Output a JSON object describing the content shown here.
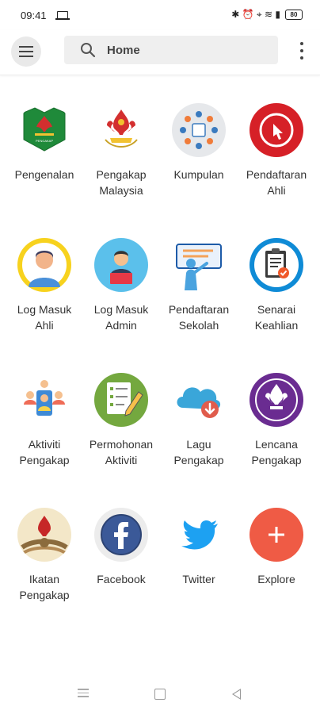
{
  "status_bar": {
    "time": "09:41",
    "right_symbols": "✱ ⏰ ⌖ ≋ ▮",
    "battery": "80"
  },
  "toolbar": {
    "search_text": "Home"
  },
  "tiles": [
    {
      "l1": "Pengenalan",
      "l2": "",
      "icon": "pengakap-emblem-icon"
    },
    {
      "l1": "Pengakap",
      "l2": "Malaysia",
      "icon": "fleur-de-lis-emblem-icon"
    },
    {
      "l1": "Kumpulan",
      "l2": "",
      "icon": "group-meeting-icon"
    },
    {
      "l1": "Pendaftaran",
      "l2": "Ahli",
      "icon": "apply-online-icon"
    },
    {
      "l1": "Log Masuk",
      "l2": "Ahli",
      "icon": "member-avatar-icon"
    },
    {
      "l1": "Log Masuk",
      "l2": "Admin",
      "icon": "admin-laptop-icon"
    },
    {
      "l1": "Pendaftaran",
      "l2": "Sekolah",
      "icon": "school-presentation-icon"
    },
    {
      "l1": "Senarai",
      "l2": "Keahlian",
      "icon": "clipboard-check-icon"
    },
    {
      "l1": "Aktiviti",
      "l2": "Pengakap",
      "icon": "people-network-icon"
    },
    {
      "l1": "Permohonan",
      "l2": "Aktiviti",
      "icon": "form-pencil-icon"
    },
    {
      "l1": "Lagu",
      "l2": "Pengakap",
      "icon": "cloud-download-icon"
    },
    {
      "l1": "Lencana",
      "l2": "Pengakap",
      "icon": "scout-badge-icon"
    },
    {
      "l1": "Ikatan",
      "l2": "Pengakap",
      "icon": "scout-knot-icon"
    },
    {
      "l1": "Facebook",
      "l2": "",
      "icon": "facebook-icon"
    },
    {
      "l1": "Twitter",
      "l2": "",
      "icon": "twitter-icon"
    },
    {
      "l1": "Explore",
      "l2": "",
      "icon": "plus-icon"
    }
  ],
  "colors": {
    "explore": "#ef5b45",
    "twitter": "#1da1f2",
    "facebook": "#3b5998",
    "badge_purple": "#6a2c91"
  }
}
